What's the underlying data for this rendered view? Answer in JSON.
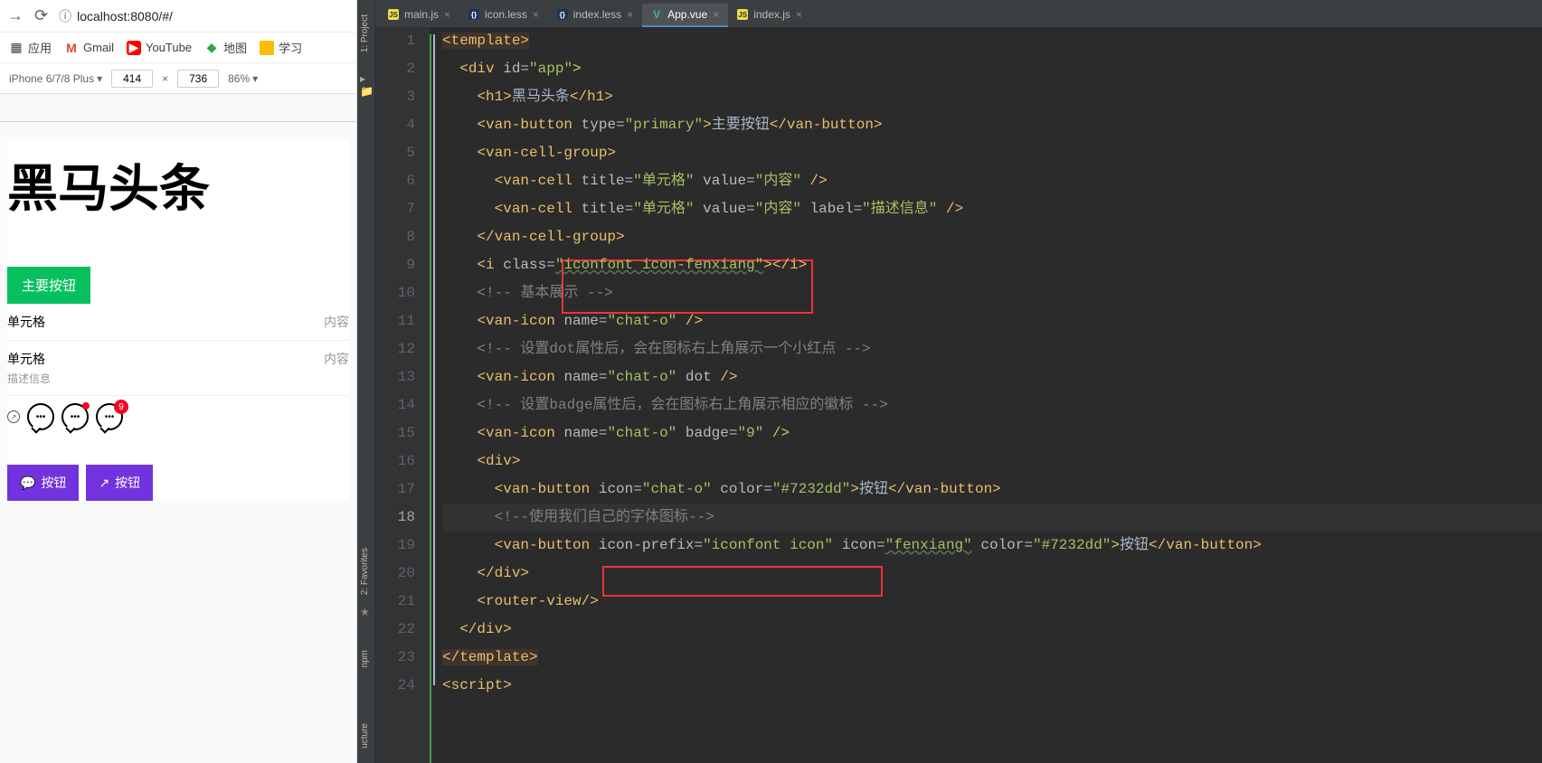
{
  "browser": {
    "url": "localhost:8080/#/",
    "bookmarks_label": "应用",
    "bookmarks": [
      {
        "label": "Gmail"
      },
      {
        "label": "YouTube"
      },
      {
        "label": "地图"
      },
      {
        "label": "学习"
      }
    ],
    "device": "iPhone 6/7/8 Plus",
    "width": "414",
    "height": "736",
    "zoom": "86%"
  },
  "preview": {
    "title": "黑马头条",
    "primary_button": "主要按钮",
    "cell1_title": "单元格",
    "cell1_value": "内容",
    "cell2_title": "单元格",
    "cell2_value": "内容",
    "cell2_label": "描述信息",
    "badge_num": "9",
    "purple_btn1": "按钮",
    "purple_btn2": "按钮"
  },
  "ide": {
    "tools": {
      "project": "1: Project",
      "favorites": "2: Favorites",
      "npm": "npm",
      "structure": "ucture"
    },
    "tabs": [
      {
        "name": "main.js",
        "type": "js",
        "active": false
      },
      {
        "name": "icon.less",
        "type": "less",
        "active": false
      },
      {
        "name": "index.less",
        "type": "less",
        "active": false
      },
      {
        "name": "App.vue",
        "type": "vue",
        "active": true
      },
      {
        "name": "index.js",
        "type": "js",
        "active": false
      }
    ],
    "current_line": 18,
    "code": {
      "l1": {
        "i": "",
        "p1": "<",
        "t": "template",
        "p2": ">"
      },
      "l2": {
        "i": "  ",
        "p1": "<",
        "t": "div ",
        "a": "id",
        "eq": "=",
        "v": "\"app\"",
        "p2": ">"
      },
      "l3": {
        "i": "    ",
        "p1": "<",
        "t": "h1",
        "p2": ">",
        "txt": "黑马头条",
        "c1": "</",
        "ct": "h1",
        "c2": ">"
      },
      "l4": {
        "i": "    ",
        "p1": "<",
        "t": "van-button ",
        "a": "type",
        "eq": "=",
        "v": "\"primary\"",
        "p2": ">",
        "txt": "主要按钮",
        "c1": "</",
        "ct": "van-button",
        "c2": ">"
      },
      "l5": {
        "i": "    ",
        "p1": "<",
        "t": "van-cell-group",
        "p2": ">"
      },
      "l6": {
        "i": "      ",
        "p1": "<",
        "t": "van-cell ",
        "a1": "title",
        "v1": "\"单元格\"",
        "a2": "value",
        "v2": "\"内容\"",
        "p2": " />"
      },
      "l7": {
        "i": "      ",
        "p1": "<",
        "t": "van-cell ",
        "a1": "title",
        "v1": "\"单元格\"",
        "a2": "value",
        "v2": "\"内容\"",
        "a3": "label",
        "v3": "\"描述信息\"",
        "p2": " />"
      },
      "l8": {
        "i": "    ",
        "p1": "</",
        "t": "van-cell-group",
        "p2": ">"
      },
      "l9": {
        "i": "    ",
        "p1": "<",
        "t": "i ",
        "a": "class",
        "eq": "=",
        "v": "\"iconfont icon-fenxiang\"",
        "p2": ">",
        "c1": "</",
        "ct": "i",
        "c2": ">"
      },
      "l10": {
        "i": "    ",
        "c": "<!-- 基本展示 -->"
      },
      "l11": {
        "i": "    ",
        "p1": "<",
        "t": "van-icon ",
        "a": "name",
        "eq": "=",
        "v": "\"chat-o\"",
        "p2": " />"
      },
      "l12": {
        "i": "    ",
        "c": "<!-- 设置dot属性后，会在图标右上角展示一个小红点 -->"
      },
      "l13": {
        "i": "    ",
        "p1": "<",
        "t": "van-icon ",
        "a1": "name",
        "v1": "\"chat-o\"",
        "a2": "dot",
        "p2": " />"
      },
      "l14": {
        "i": "    ",
        "c": "<!-- 设置badge属性后，会在图标右上角展示相应的徽标 -->"
      },
      "l15": {
        "i": "    ",
        "p1": "<",
        "t": "van-icon ",
        "a1": "name",
        "v1": "\"chat-o\"",
        "a2": "badge",
        "v2": "\"9\"",
        "p2": " />"
      },
      "l16": {
        "i": "    ",
        "p1": "<",
        "t": "div",
        "p2": ">"
      },
      "l17": {
        "i": "      ",
        "p1": "<",
        "t": "van-button ",
        "a1": "icon",
        "v1": "\"chat-o\"",
        "a2": "color",
        "v2": "\"#7232dd\"",
        "p2": ">",
        "txt": "按钮",
        "c1": "</",
        "ct": "van-button",
        "c2": ">"
      },
      "l18": {
        "i": "      ",
        "c": "<!--使用我们自己的字体图标-->"
      },
      "l19": {
        "i": "      ",
        "p1": "<",
        "t": "van-button ",
        "a1": "icon-prefix",
        "v1": "\"iconfont icon\"",
        "a2": "icon",
        "v2": "\"fenxiang\"",
        "a3": "color",
        "v3": "\"#7232dd\"",
        "p2": ">",
        "txt": "按钮",
        "c1": "</",
        "ct": "van-button",
        "c2": ">"
      },
      "l20": {
        "i": "    ",
        "p1": "</",
        "t": "div",
        "p2": ">"
      },
      "l21": {
        "i": "    ",
        "p1": "<",
        "t": "router-view",
        "p2": "/>"
      },
      "l22": {
        "i": "  ",
        "p1": "</",
        "t": "div",
        "p2": ">"
      },
      "l23": {
        "i": "",
        "p1": "</",
        "t": "template",
        "p2": ">"
      },
      "l24": {
        "i": "",
        "p1": "<",
        "t": "script",
        "p2": ">"
      }
    }
  }
}
